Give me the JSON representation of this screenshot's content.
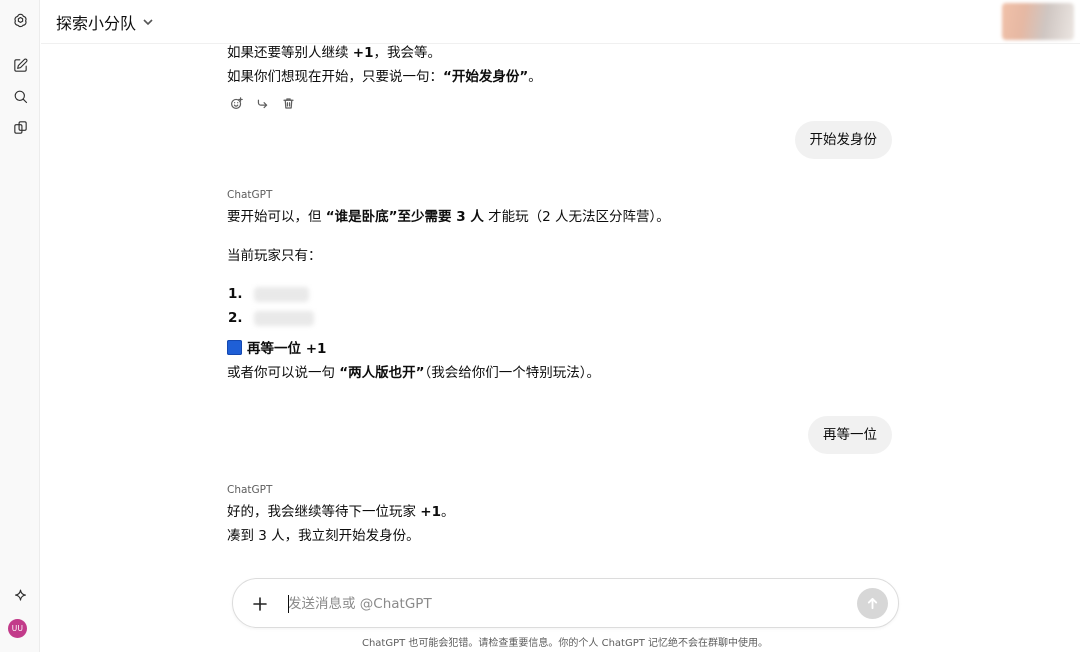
{
  "header": {
    "group_title": "探索小分队"
  },
  "rail": {
    "avatar_initials": "UU"
  },
  "messages": {
    "m1": {
      "line1_pre": "如果还要等别人继续 ",
      "line1_bold": "+1",
      "line1_post": "，我会等。",
      "line2_pre": "如果你们想现在开始，只要说一句：",
      "line2_bold": "“开始发身份”",
      "line2_post": "。"
    },
    "user1": "开始发身份",
    "a1": {
      "sender": "ChatGPT",
      "p1_pre": "要开始可以，但 ",
      "p1_bold": "“谁是卧底”至少需要 3 人",
      "p1_post": " 才能玩（2 人无法区分阵营）。",
      "p2": "当前玩家只有：",
      "list_nums": [
        "1.",
        "2."
      ],
      "wait_label": "再等一位 +1",
      "p4_pre": "或者你可以说一句 ",
      "p4_bold": "“两人版也开”",
      "p4_post": "（我会给你们一个特别玩法）。"
    },
    "user2": "再等一位",
    "a2": {
      "sender": "ChatGPT",
      "l1_pre": "好的，我会继续等待下一位玩家 ",
      "l1_bold": "+1",
      "l1_post": "。",
      "l2": "凑到 3 人，我立刻开始发身份。"
    }
  },
  "composer": {
    "placeholder": "发送消息或 @ChatGPT"
  },
  "disclaimer": "ChatGPT 也可能会犯错。请检查重要信息。你的个人 ChatGPT 记忆绝不会在群聊中使用。"
}
